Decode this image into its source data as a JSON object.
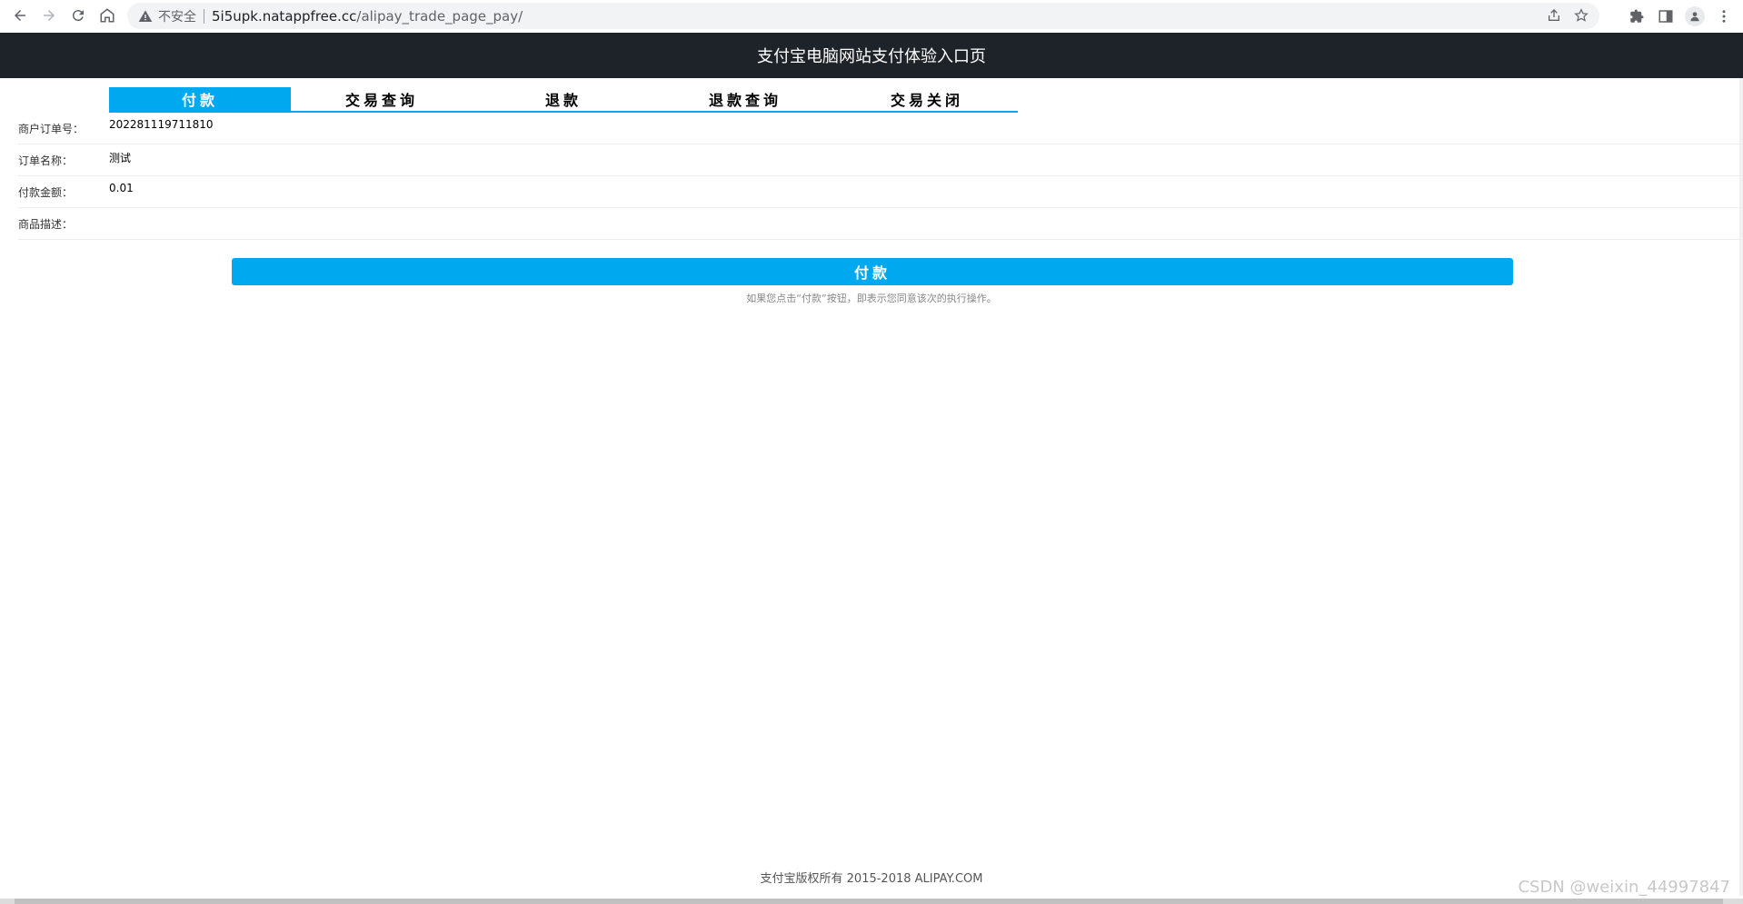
{
  "browser": {
    "security_label": "不安全",
    "url_host": "5i5upk.natappfree.cc",
    "url_path": "/alipay_trade_page_pay/"
  },
  "page": {
    "header_title": "支付宝电脑网站支付体验入口页"
  },
  "tabs": [
    {
      "label": "付款",
      "active": true
    },
    {
      "label": "交易查询",
      "active": false
    },
    {
      "label": "退款",
      "active": false
    },
    {
      "label": "退款查询",
      "active": false
    },
    {
      "label": "交易关闭",
      "active": false
    }
  ],
  "form": {
    "rows": [
      {
        "label": "商户订单号：",
        "value": "202281119711810"
      },
      {
        "label": "订单名称：",
        "value": "测试"
      },
      {
        "label": "付款金额：",
        "value": "0.01"
      },
      {
        "label": "商品描述：",
        "value": ""
      }
    ]
  },
  "pay": {
    "button_label": "付款",
    "note": "如果您点击“付款”按钮，即表示您同意该次的执行操作。"
  },
  "footer": {
    "copyright": "支付宝版权所有 2015-2018 ALIPAY.COM",
    "watermark": "CSDN @weixin_44997847"
  },
  "colors": {
    "accent": "#00a8f0",
    "header_bg": "#1e2229"
  }
}
